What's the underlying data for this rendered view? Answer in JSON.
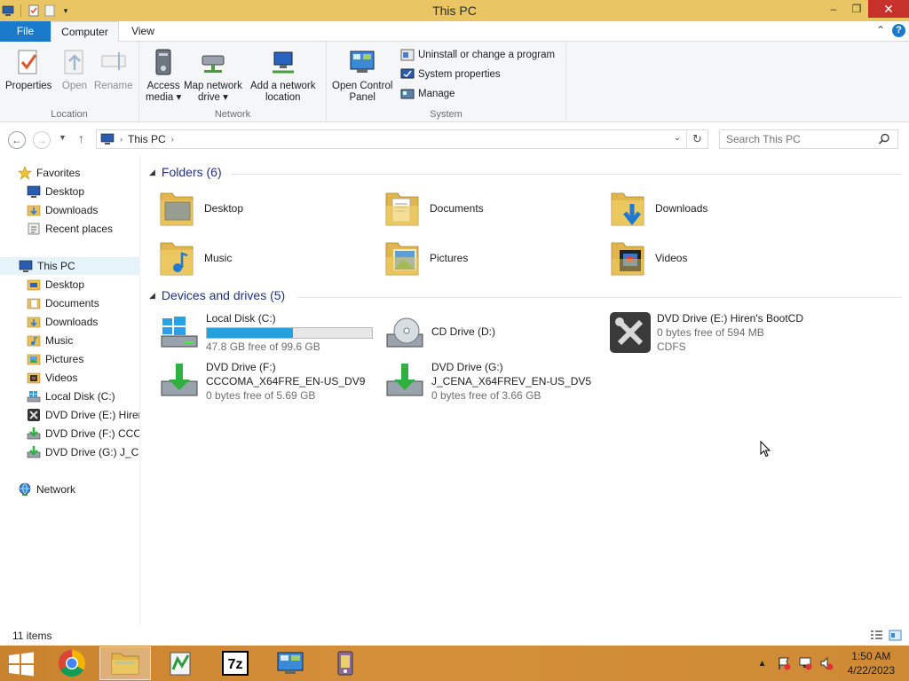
{
  "window": {
    "title": "This PC"
  },
  "titlebar": {
    "minimize": "–",
    "maximize": "❐",
    "close": "✕"
  },
  "ribbon_tabs": [
    "File",
    "Computer",
    "View"
  ],
  "ribbon": {
    "location": {
      "label": "Location",
      "properties": "Properties",
      "open": "Open",
      "rename": "Rename"
    },
    "network": {
      "label": "Network",
      "access_media_1": "Access",
      "access_media_2": "media ▾",
      "map_drive_1": "Map network",
      "map_drive_2": "drive ▾",
      "add_location_1": "Add a network",
      "add_location_2": "location"
    },
    "system": {
      "label": "System",
      "open_cp_1": "Open Control",
      "open_cp_2": "Panel",
      "uninstall": "Uninstall or change a program",
      "system_properties": "System properties",
      "manage": "Manage"
    }
  },
  "address": {
    "crumb": "This PC",
    "search_placeholder": "Search This PC"
  },
  "navpane": {
    "favorites": "Favorites",
    "fav_items": [
      "Desktop",
      "Downloads",
      "Recent places"
    ],
    "this_pc": "This PC",
    "pc_items": [
      "Desktop",
      "Documents",
      "Downloads",
      "Music",
      "Pictures",
      "Videos",
      "Local Disk (C:)",
      "DVD Drive (E:) Hiren",
      "DVD Drive (F:) CCCC",
      "DVD Drive (G:) J_CEN"
    ],
    "network": "Network"
  },
  "folders": {
    "header": "Folders (6)",
    "items": [
      "Desktop",
      "Documents",
      "Downloads",
      "Music",
      "Pictures",
      "Videos"
    ]
  },
  "drives": {
    "header": "Devices and drives (5)",
    "c": {
      "name": "Local Disk (C:)",
      "free": "47.8 GB free of 99.6 GB",
      "used_fraction": 0.52
    },
    "d": {
      "name": "CD Drive (D:)"
    },
    "e": {
      "name": "DVD Drive (E:) Hiren's BootCD",
      "free": "0 bytes free of 594 MB",
      "fs": "CDFS"
    },
    "f": {
      "name": "DVD Drive (F:)",
      "label": "CCCOMA_X64FRE_EN-US_DV9",
      "free": "0 bytes free of 5.69 GB"
    },
    "g": {
      "name": "DVD Drive (G:)",
      "label": "J_CENA_X64FREV_EN-US_DV5",
      "free": "0 bytes free of 3.66 GB"
    }
  },
  "status": {
    "count": "11 items"
  },
  "taskbar": {
    "time": "1:50 AM",
    "date": "4/22/2023"
  }
}
